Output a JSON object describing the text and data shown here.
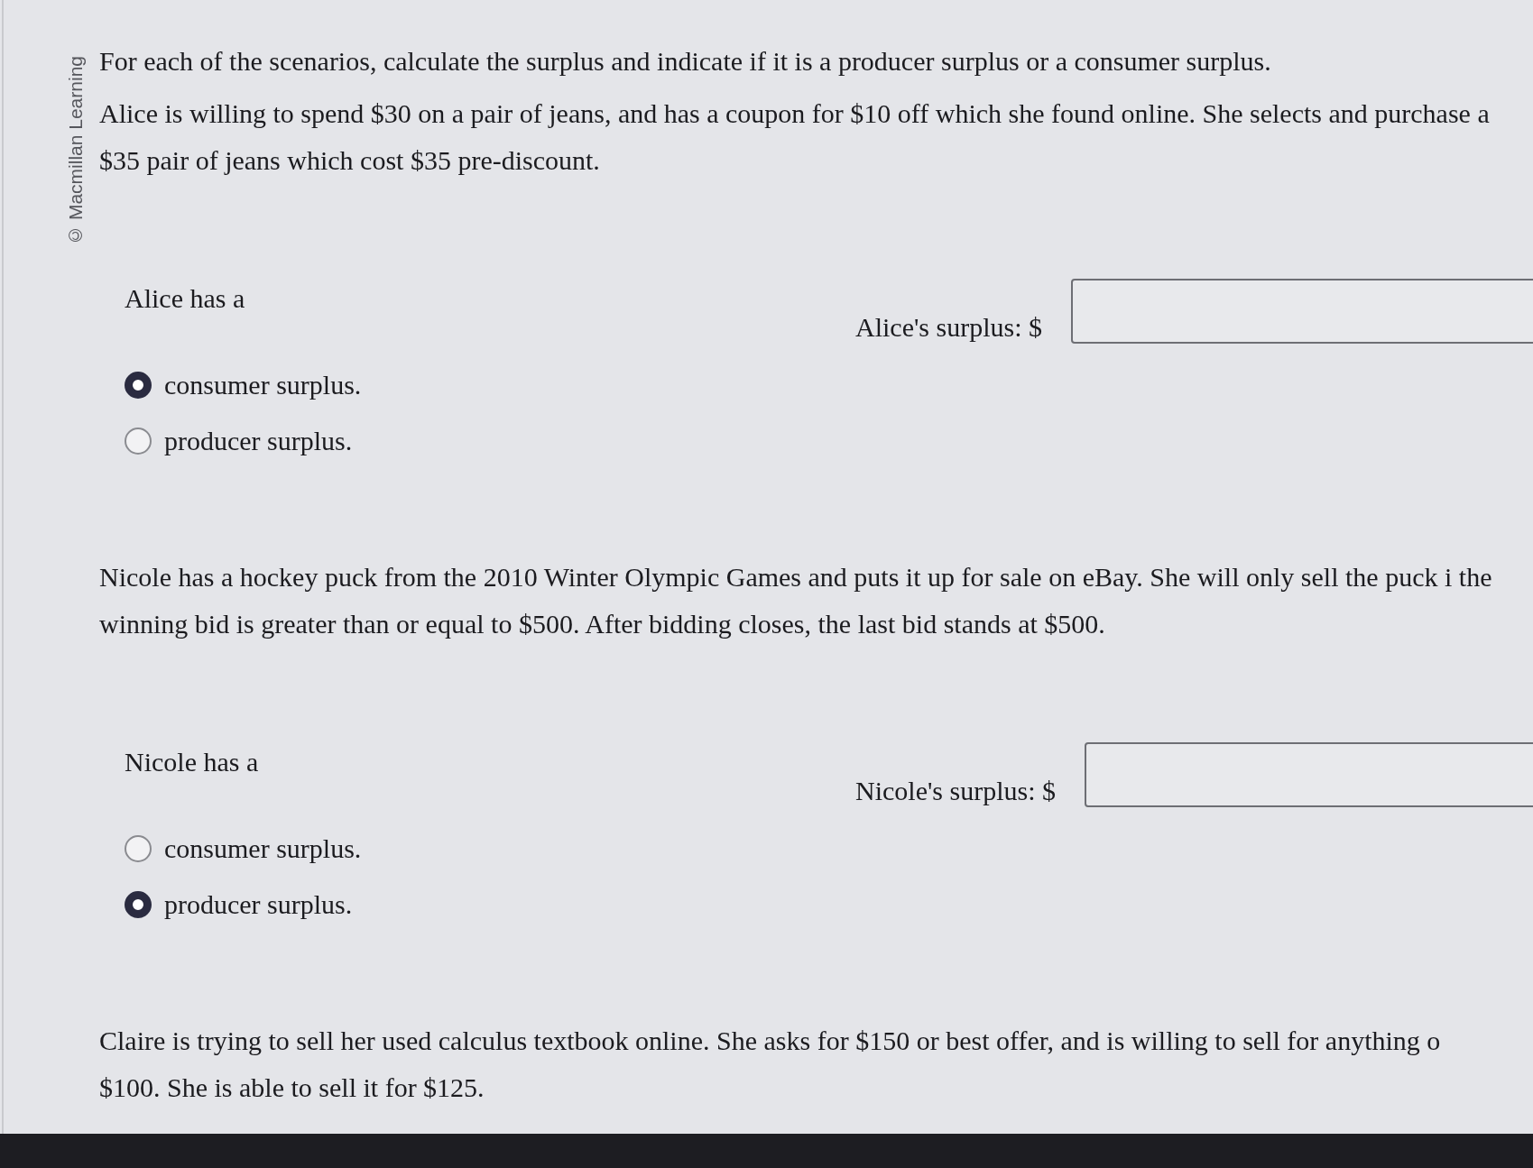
{
  "copyright": "© Macmillan Learning",
  "instruction": "For each of the scenarios, calculate the surplus and indicate if it is a producer surplus or a consumer surplus.",
  "scenarios": [
    {
      "text": "Alice is willing to spend $30 on a pair of jeans, and has a coupon for $10 off which she found online. She selects and purchase a $35 pair of jeans which cost $35 pre-discount.",
      "prompt": "Alice has a",
      "options": [
        {
          "label": "consumer surplus.",
          "selected": true
        },
        {
          "label": "producer surplus.",
          "selected": false
        }
      ],
      "surplus_label": "Alice's surplus: $"
    },
    {
      "text": "Nicole has a hockey puck from the 2010 Winter Olympic Games and puts it up for sale on eBay. She will only sell the puck i the winning bid is greater than or equal to $500. After bidding closes, the last bid stands at $500.",
      "prompt": "Nicole has a",
      "options": [
        {
          "label": "consumer surplus.",
          "selected": false
        },
        {
          "label": "producer surplus.",
          "selected": true
        }
      ],
      "surplus_label": "Nicole's surplus: $"
    },
    {
      "text": "Claire is trying to sell her used calculus textbook online. She asks for $150 or best offer, and is willing to sell for anything o $100. She is able to sell it for $125."
    }
  ]
}
